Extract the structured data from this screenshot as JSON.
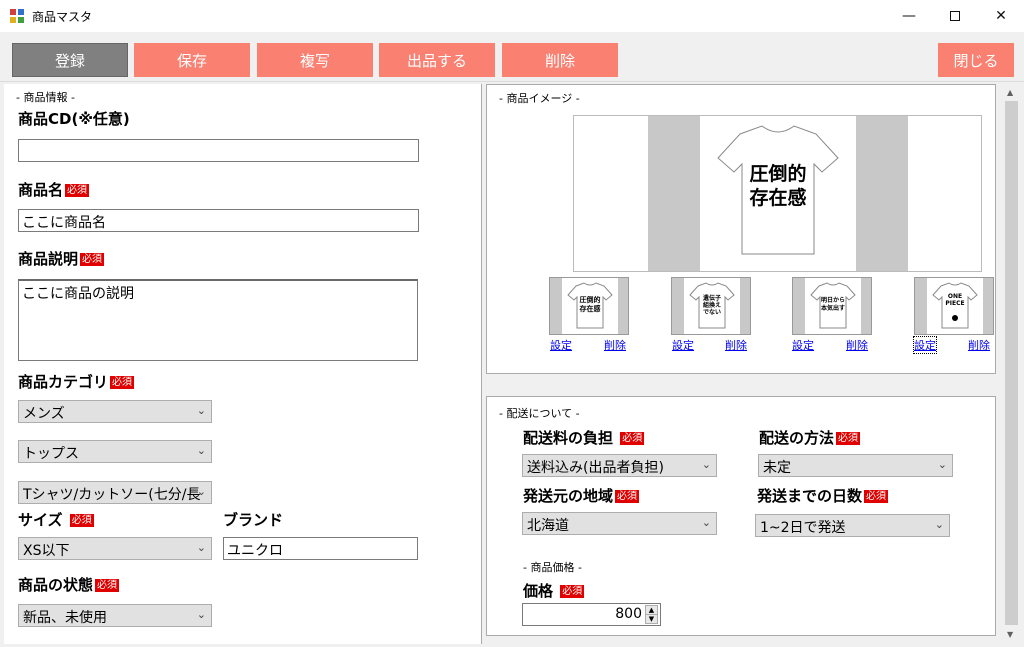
{
  "window": {
    "title": "商品マスタ"
  },
  "toolbar": {
    "register": "登録",
    "save": "保存",
    "copy": "複写",
    "list": "出品する",
    "delete": "削除",
    "close": "閉じる"
  },
  "required_badge": "必須",
  "product_info": {
    "group_title": "- 商品情報 -",
    "product_cd_label": "商品CD(※任意)",
    "product_cd_value": "",
    "name_label": "商品名",
    "name_value": "ここに商品名",
    "desc_label": "商品説明",
    "desc_value": "ここに商品の説明",
    "category_label": "商品カテゴリ",
    "category1": "メンズ",
    "category2": "トップス",
    "category3": "Tシャツ/カットソー(七分/長",
    "size_label": "サイズ",
    "size_value": "XS以下",
    "brand_label": "ブランド",
    "brand_value": "ユニクロ",
    "condition_label": "商品の状態",
    "condition_value": "新品、未使用"
  },
  "image": {
    "group_title": "- 商品イメージ -",
    "main_print": [
      "圧倒的",
      "存在感"
    ],
    "thumbnails": [
      {
        "print": [
          "圧倒的",
          "存在感"
        ],
        "set": "設定",
        "del": "削除"
      },
      {
        "print": [
          "遺伝子",
          "組換え",
          "でない"
        ],
        "set": "設定",
        "del": "削除"
      },
      {
        "print": [
          "明日から",
          "本気出す"
        ],
        "set": "設定",
        "del": "削除"
      },
      {
        "print": [
          "ONE",
          "PIECE"
        ],
        "set": "設定",
        "del": "削除"
      }
    ]
  },
  "shipping": {
    "group_title": "- 配送について -",
    "fee_label": "配送料の負担",
    "fee_value": "送料込み(出品者負担)",
    "method_label": "配送の方法",
    "method_value": "未定",
    "origin_label": "発送元の地域",
    "origin_value": "北海道",
    "days_label": "発送までの日数",
    "days_value": "1~2日で発送",
    "price_group_title": "- 商品価格 -",
    "price_label": "価格",
    "price_value": "800"
  }
}
